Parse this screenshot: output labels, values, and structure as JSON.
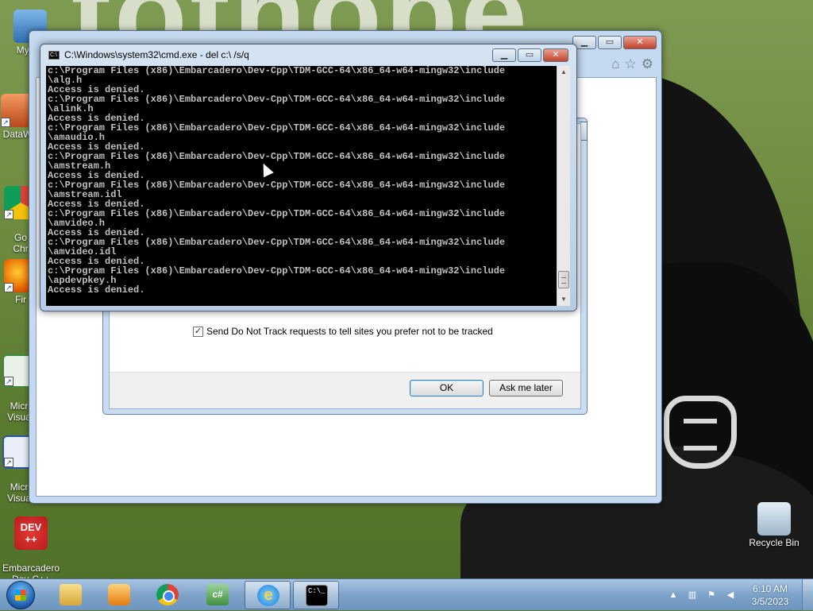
{
  "desktop": {
    "wallpaper_text": "tothobe",
    "icons": [
      {
        "label": "My Co",
        "icon": "computer-icon"
      },
      {
        "label": "DataW",
        "icon": "data-icon"
      },
      {
        "label": "Go\nChr",
        "icon": "chrome-icon"
      },
      {
        "label": "Fir",
        "icon": "firefox-icon"
      },
      {
        "label": "Micr\nVisua",
        "icon": "visual-studio-icon"
      },
      {
        "label": "Micr\nVisua",
        "icon": "visual-basic-icon"
      },
      {
        "label": "Embarcadero\nDev-C++",
        "icon": "devcpp-icon",
        "badge": "DEV\n++"
      },
      {
        "label": "Recycle Bin",
        "icon": "recycle-bin-icon"
      }
    ]
  },
  "ie_dialog": {
    "dnt_checkbox": {
      "checked": true,
      "mark": "✓",
      "label": "Send Do Not Track requests to tell sites you prefer not to be tracked"
    },
    "ok_label": "OK",
    "later_label": "Ask me later"
  },
  "cmd": {
    "title": "C:\\Windows\\system32\\cmd.exe - del  c:\\ /s/q",
    "icon_text": "C:\\",
    "lines": [
      "c:\\Program Files (x86)\\Embarcadero\\Dev-Cpp\\TDM-GCC-64\\x86_64-w64-mingw32\\include",
      "\\alg.h",
      "Access is denied.",
      "c:\\Program Files (x86)\\Embarcadero\\Dev-Cpp\\TDM-GCC-64\\x86_64-w64-mingw32\\include",
      "\\alink.h",
      "Access is denied.",
      "c:\\Program Files (x86)\\Embarcadero\\Dev-Cpp\\TDM-GCC-64\\x86_64-w64-mingw32\\include",
      "\\amaudio.h",
      "Access is denied.",
      "c:\\Program Files (x86)\\Embarcadero\\Dev-Cpp\\TDM-GCC-64\\x86_64-w64-mingw32\\include",
      "\\amstream.h",
      "Access is denied.",
      "c:\\Program Files (x86)\\Embarcadero\\Dev-Cpp\\TDM-GCC-64\\x86_64-w64-mingw32\\include",
      "\\amstream.idl",
      "Access is denied.",
      "c:\\Program Files (x86)\\Embarcadero\\Dev-Cpp\\TDM-GCC-64\\x86_64-w64-mingw32\\include",
      "\\amvideo.h",
      "Access is denied.",
      "c:\\Program Files (x86)\\Embarcadero\\Dev-Cpp\\TDM-GCC-64\\x86_64-w64-mingw32\\include",
      "\\amvideo.idl",
      "Access is denied.",
      "c:\\Program Files (x86)\\Embarcadero\\Dev-Cpp\\TDM-GCC-64\\x86_64-w64-mingw32\\include",
      "\\apdevpkey.h",
      "Access is denied."
    ],
    "colors": {
      "background": "#000000",
      "text": "#c0c0c0"
    }
  },
  "taskbar": {
    "items": [
      {
        "name": "file-explorer",
        "icon": "folder-icon"
      },
      {
        "name": "media-player",
        "icon": "media-player-icon"
      },
      {
        "name": "google-chrome",
        "icon": "chrome-icon"
      },
      {
        "name": "csharp-ide",
        "icon": "csharp-icon",
        "text": "c#"
      },
      {
        "name": "internet-explorer",
        "icon": "ie-icon",
        "text": "e",
        "active": true
      },
      {
        "name": "command-prompt",
        "icon": "cmd-icon",
        "text": "C:\\_",
        "active": true
      }
    ],
    "clock": {
      "time": "6:10 AM",
      "date": "3/5/2023"
    }
  }
}
